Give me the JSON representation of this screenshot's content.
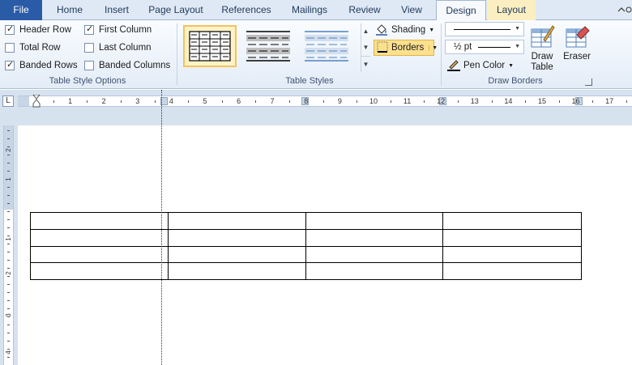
{
  "tabs": {
    "file": "File",
    "home": "Home",
    "insert": "Insert",
    "page_layout": "Page Layout",
    "references": "References",
    "mailings": "Mailings",
    "review": "Review",
    "view": "View",
    "design": "Design",
    "layout": "Layout"
  },
  "table_style_options": {
    "label": "Table Style Options",
    "header_row": {
      "label": "Header Row",
      "checked": true
    },
    "total_row": {
      "label": "Total Row",
      "checked": false
    },
    "banded_rows": {
      "label": "Banded Rows",
      "checked": true
    },
    "first_column": {
      "label": "First Column",
      "checked": true
    },
    "last_column": {
      "label": "Last Column",
      "checked": false
    },
    "banded_columns": {
      "label": "Banded Columns",
      "checked": false
    }
  },
  "table_styles": {
    "label": "Table Styles",
    "shading": "Shading",
    "borders": "Borders"
  },
  "draw_borders": {
    "label": "Draw Borders",
    "pen_weight": "½ pt",
    "pen_color": "Pen Color",
    "draw_table_line1": "Draw",
    "draw_table_line2": "Table",
    "eraser": "Eraser"
  },
  "hruler": {
    "numbers": [
      "1",
      "2",
      "3",
      "4",
      "5",
      "6",
      "7",
      "8",
      "9",
      "10",
      "11",
      "12",
      "13",
      "14",
      "15",
      "16",
      "17"
    ]
  },
  "vruler": {
    "numbers": [
      "2",
      "1",
      "1",
      "2",
      "3",
      "4"
    ]
  },
  "document": {
    "table": {
      "rows": 4,
      "cols": 4
    }
  },
  "colors": {
    "file_tab": "#2a5ba6",
    "ribbon_bg": "#e3ecf7",
    "accent_selected": "#fbe08e"
  }
}
